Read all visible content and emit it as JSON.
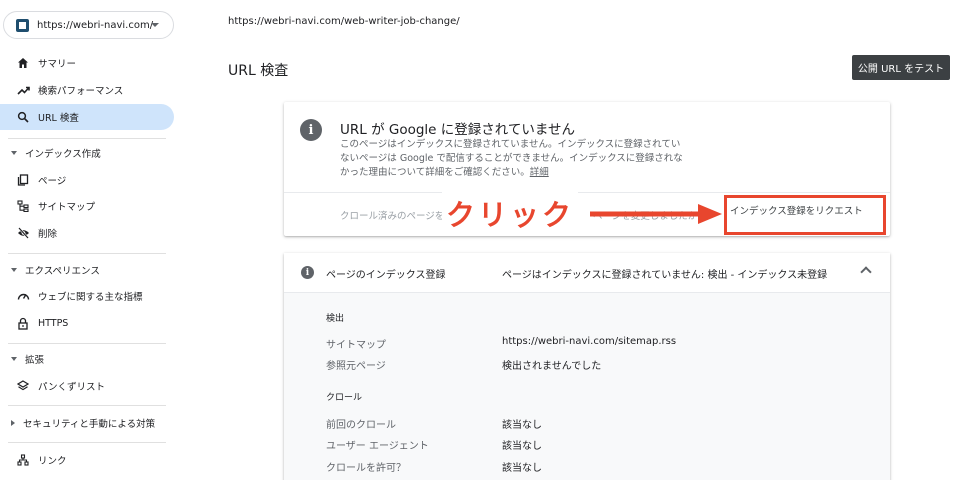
{
  "property": {
    "label": "https://webri-navi.com/"
  },
  "sidebar": {
    "items": [
      {
        "label": "サマリー",
        "icon": "home-icon"
      },
      {
        "label": "検索パフォーマンス",
        "icon": "trending-up-icon"
      },
      {
        "label": "URL 検査",
        "icon": "search-icon",
        "active": true
      }
    ],
    "sections": [
      {
        "label": "インデックス作成",
        "items": [
          {
            "label": "ページ",
            "icon": "pages-icon"
          },
          {
            "label": "サイトマップ",
            "icon": "sitemap-icon"
          },
          {
            "label": "削除",
            "icon": "eye-off-icon"
          }
        ]
      },
      {
        "label": "エクスペリエンス",
        "items": [
          {
            "label": "ウェブに関する主な指標",
            "icon": "speedometer-icon"
          },
          {
            "label": "HTTPS",
            "icon": "lock-icon"
          }
        ]
      },
      {
        "label": "拡張",
        "items": [
          {
            "label": "パンくずリスト",
            "icon": "layers-icon"
          }
        ]
      },
      {
        "label": "セキュリティと手動による対策",
        "items": []
      }
    ],
    "bottom_item": {
      "label": "リンク",
      "icon": "links-icon"
    }
  },
  "topbar": {
    "url": "https://webri-navi.com/web-writer-job-change/"
  },
  "page": {
    "title": "URL 検査",
    "test_button": "公開 URL をテスト"
  },
  "card": {
    "title": "URL が Google に登録されていません",
    "description_lines": [
      "このページはインデックスに登録されていません。インデックスに登録されてい",
      "ないページは Google で配信することができません。インデックスに登録されな",
      "かった理由について詳細をご確認ください。"
    ],
    "detail_link": "詳細",
    "footer_left": "クロール済みのページを表示",
    "footer_mid": "ページを変更しましたか？",
    "request_button": "インデックス登録をリクエスト"
  },
  "annotation": {
    "text": "クリック",
    "color": "#e8462e"
  },
  "panel": {
    "label": "ページのインデックス登録",
    "status": "ページはインデックスに登録されていません: 検出 - インデックス未登録",
    "sections": [
      {
        "title": "検出",
        "rows": [
          {
            "key": "サイトマップ",
            "value": "https://webri-navi.com/sitemap.rss"
          },
          {
            "key": "参照元ページ",
            "value": "検出されませんでした"
          }
        ]
      },
      {
        "title": "クロール",
        "rows": [
          {
            "key": "前回のクロール",
            "value": "該当なし"
          },
          {
            "key": "ユーザー エージェント",
            "value": "該当なし"
          },
          {
            "key": "クロールを許可？",
            "value": "該当なし"
          }
        ]
      }
    ]
  },
  "colors": {
    "active_nav": "#cfe4fb",
    "button_dark": "#3c4043",
    "annotation": "#e8462e"
  }
}
